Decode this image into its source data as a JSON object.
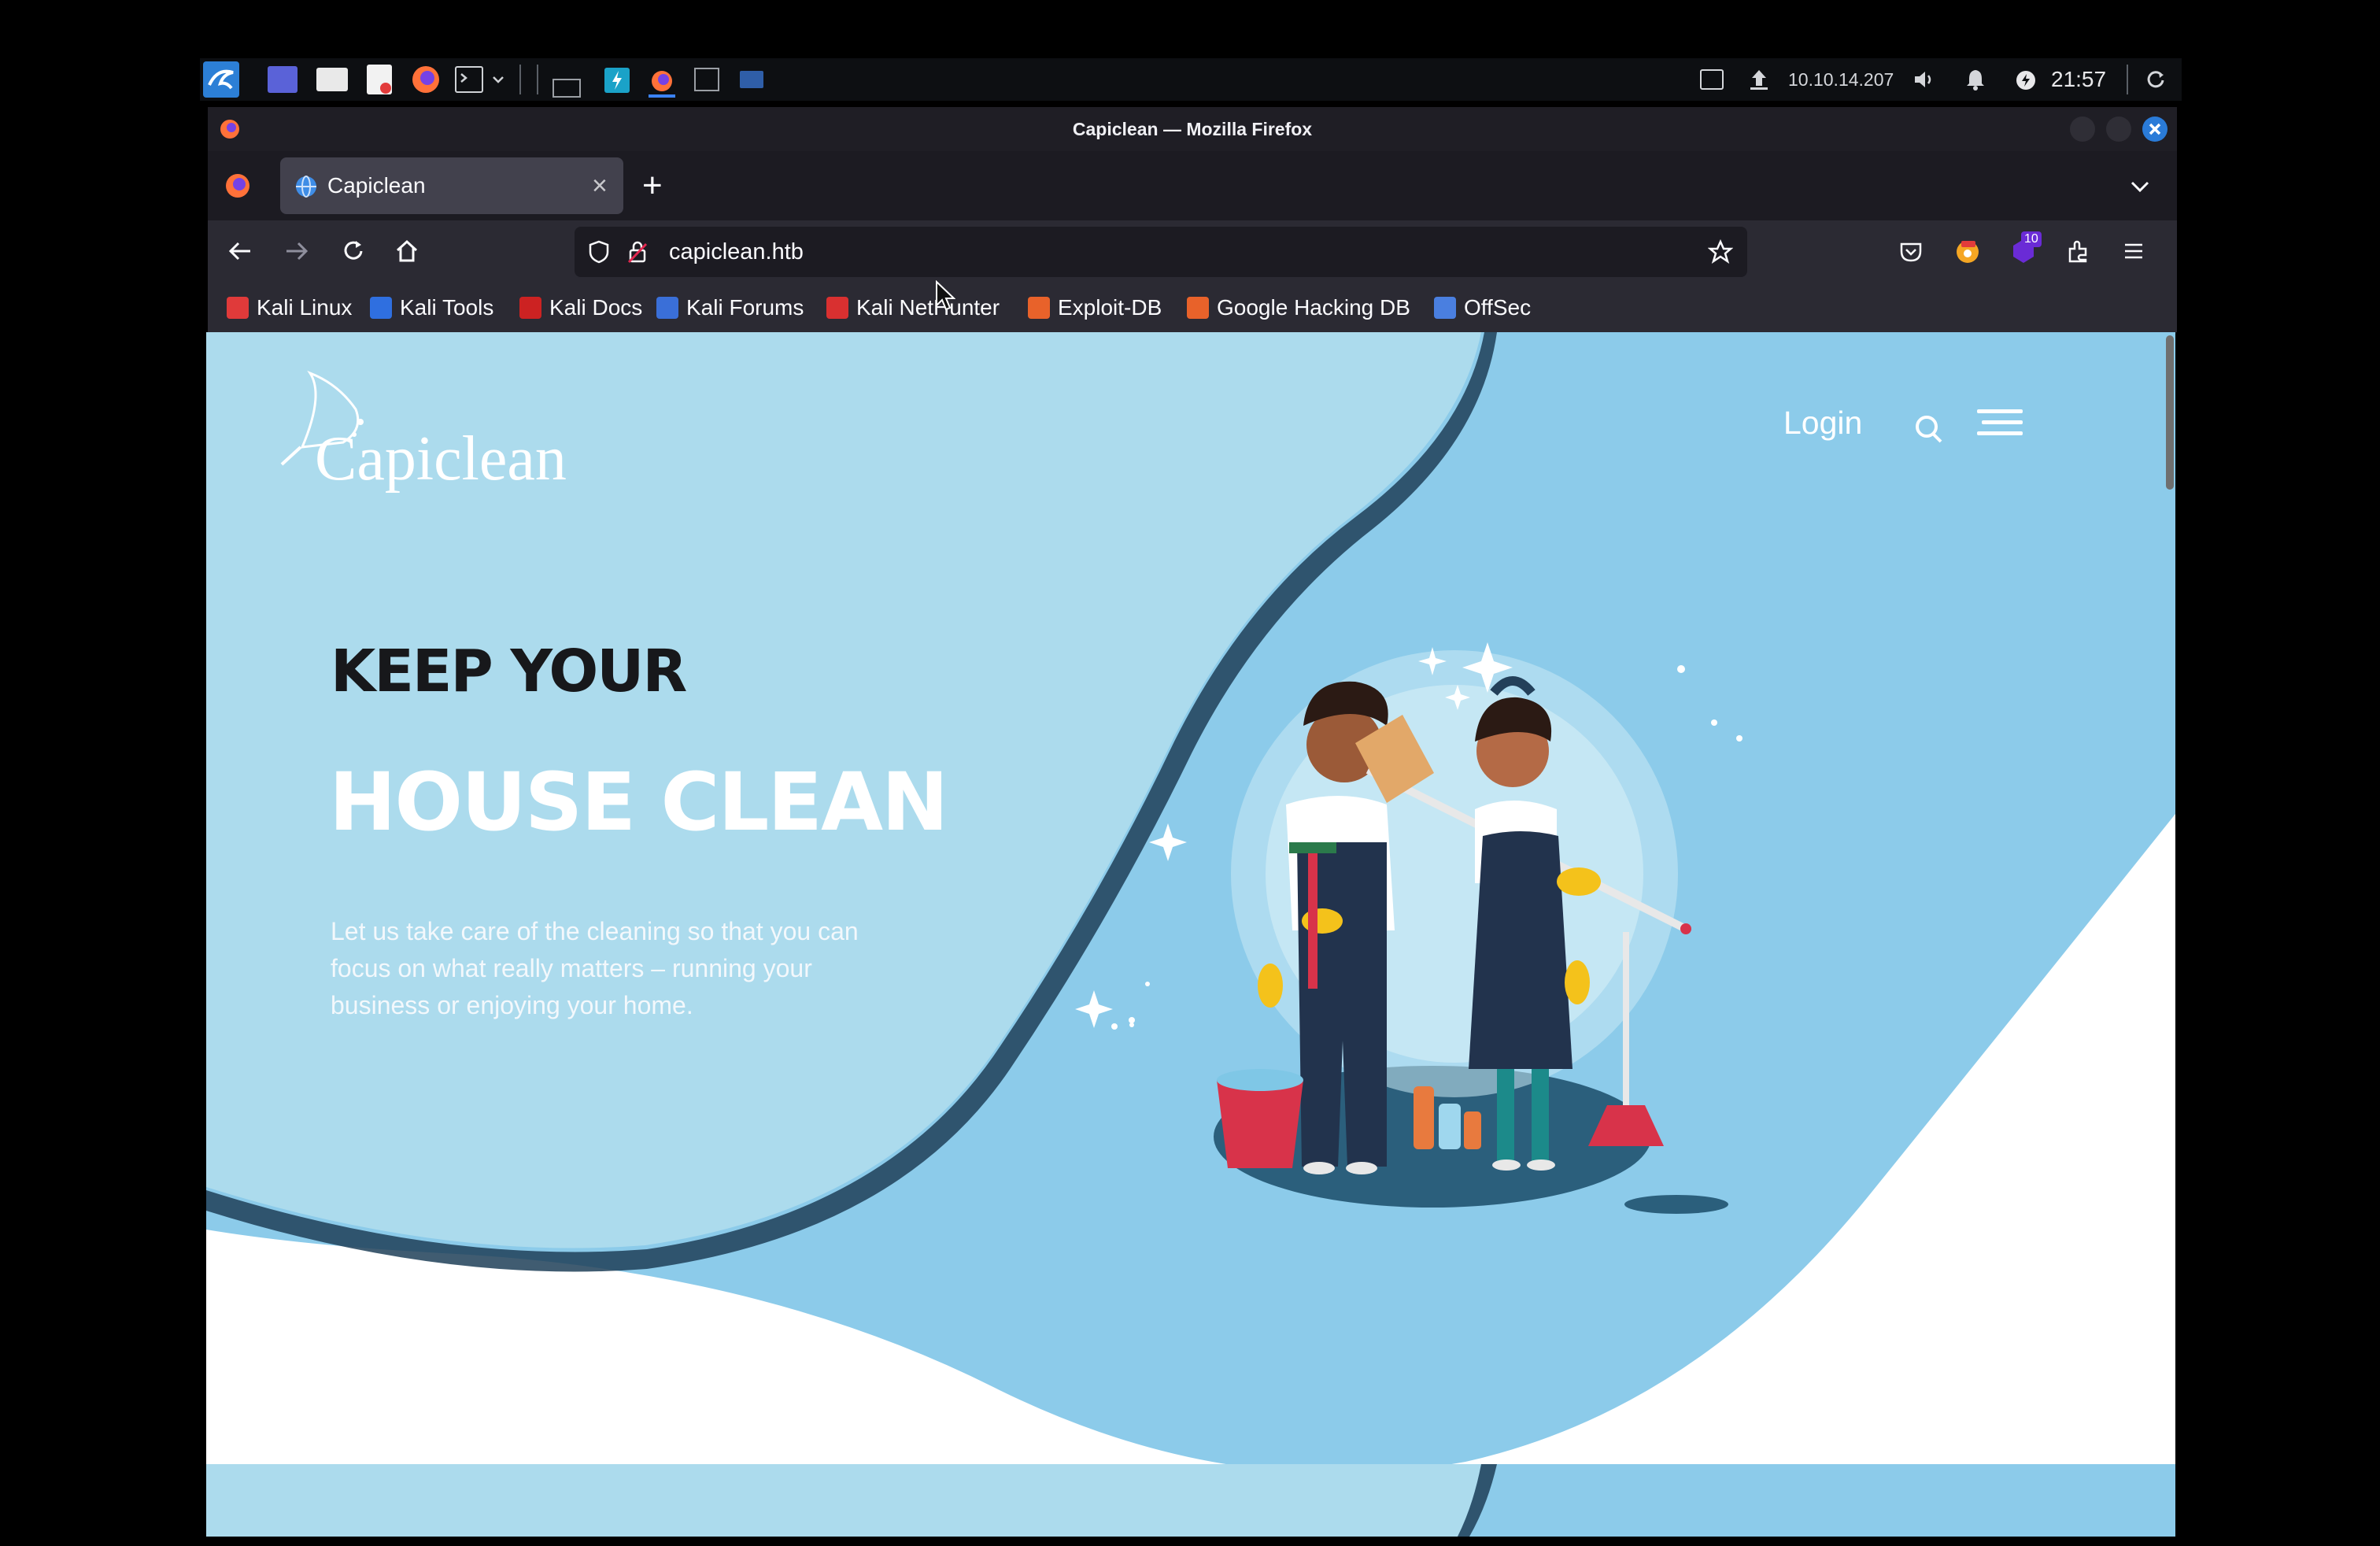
{
  "taskbar": {
    "ip": "10.10.14.207",
    "clock": "21:57"
  },
  "window": {
    "title": "Capiclean — Mozilla Firefox"
  },
  "tabs": [
    {
      "label": "Capiclean",
      "close": "×"
    }
  ],
  "new_tab": "+",
  "address": {
    "url": "capiclean.htb"
  },
  "bookmarks": [
    {
      "label": "Kali Linux",
      "color": "#e03a3a"
    },
    {
      "label": "Kali Tools",
      "color": "#2f6fe0"
    },
    {
      "label": "Kali Docs",
      "color": "#cc2222"
    },
    {
      "label": "Kali Forums",
      "color": "#3a6fd8"
    },
    {
      "label": "Kali NetHunter",
      "color": "#d93030"
    },
    {
      "label": "Exploit-DB",
      "color": "#e8622a"
    },
    {
      "label": "Google Hacking DB",
      "color": "#e8622a"
    },
    {
      "label": "OffSec",
      "color": "#4a7fe0"
    }
  ],
  "toolbar": {
    "badge_count": "10"
  },
  "site": {
    "logo": "Capiclean",
    "nav": {
      "login": "Login"
    },
    "hero": {
      "line1": "KEEP YOUR",
      "line2": "HOUSE CLEAN",
      "text": "Let us take care of the cleaning so that you can focus on what really matters – running your business or enjoying your home."
    }
  },
  "colors": {
    "hero_light": "#acdbed",
    "hero_mid": "#8ccbea",
    "accent_dark": "#2d4a5e"
  }
}
